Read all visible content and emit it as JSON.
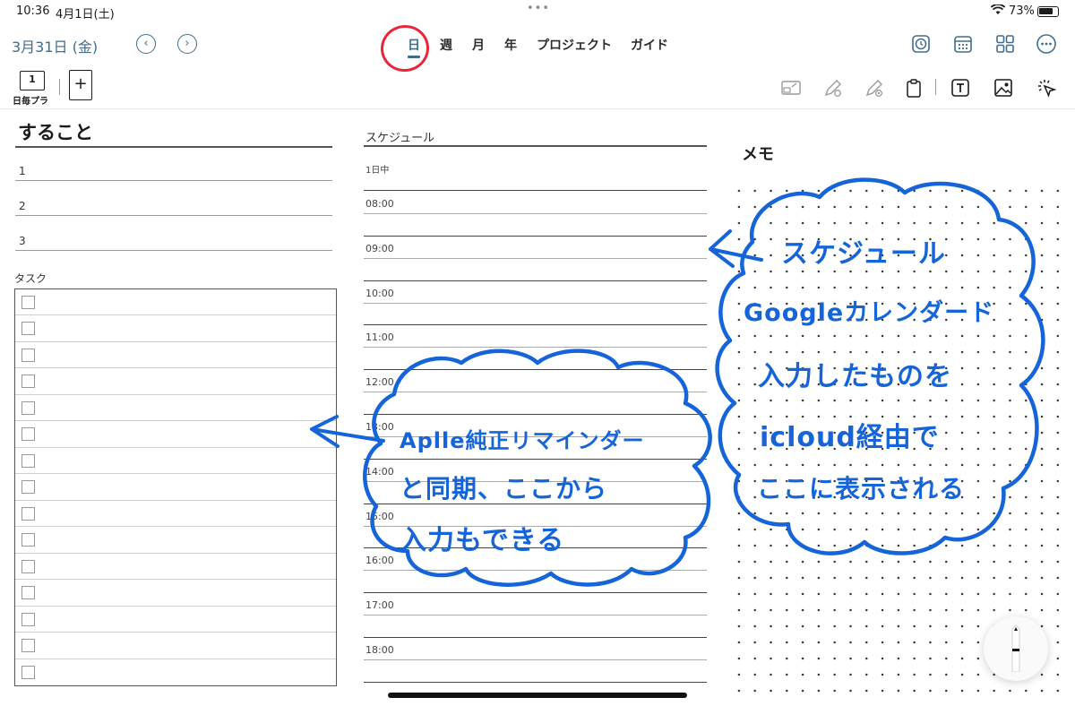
{
  "status_bar": {
    "time": "10:36",
    "date": "4月1日(土)",
    "battery": "73%",
    "battery_level": 0.73
  },
  "header": {
    "current_date": "3月31日 (金)",
    "tabs": [
      {
        "label": "日",
        "active": true
      },
      {
        "label": "週",
        "active": false
      },
      {
        "label": "月",
        "active": false
      },
      {
        "label": "年",
        "active": false
      },
      {
        "label": "プロジェクト",
        "active": false
      },
      {
        "label": "ガイド",
        "active": false
      }
    ],
    "right_icons": [
      "clock-icon",
      "calendar-icon",
      "grid-icon",
      "more-icon"
    ]
  },
  "toolbar": {
    "template_number": "1",
    "template_label": "日毎プラ",
    "add_page": "+",
    "tools": [
      "lasso-shape-icon",
      "pen-icon",
      "highlighter-icon",
      "clipboard-icon",
      "text-tool-icon",
      "image-icon",
      "selection-icon"
    ]
  },
  "todo": {
    "title": "すること",
    "items": [
      "1",
      "2",
      "3"
    ]
  },
  "tasks": {
    "label": "タスク",
    "rows": 15
  },
  "schedule": {
    "title": "スケジュール",
    "all_day": "1日中",
    "hours": [
      "08:00",
      "09:00",
      "10:00",
      "11:00",
      "12:00",
      "13:00",
      "14:00",
      "15:00",
      "16:00",
      "17:00",
      "18:00"
    ]
  },
  "memo": {
    "title": "メモ"
  },
  "annotations": {
    "left_note": [
      "Apllе純正リマインダー",
      "と同期、ここから",
      "入力もできる"
    ],
    "right_note": [
      "スケジュール",
      "Googleカレンダード",
      "入力したものを",
      "icloud経由で",
      "ここに表示される"
    ]
  },
  "colors": {
    "accent": "#3f6e8c",
    "ink": "#1565d8",
    "highlight_circle": "#e8263a"
  }
}
